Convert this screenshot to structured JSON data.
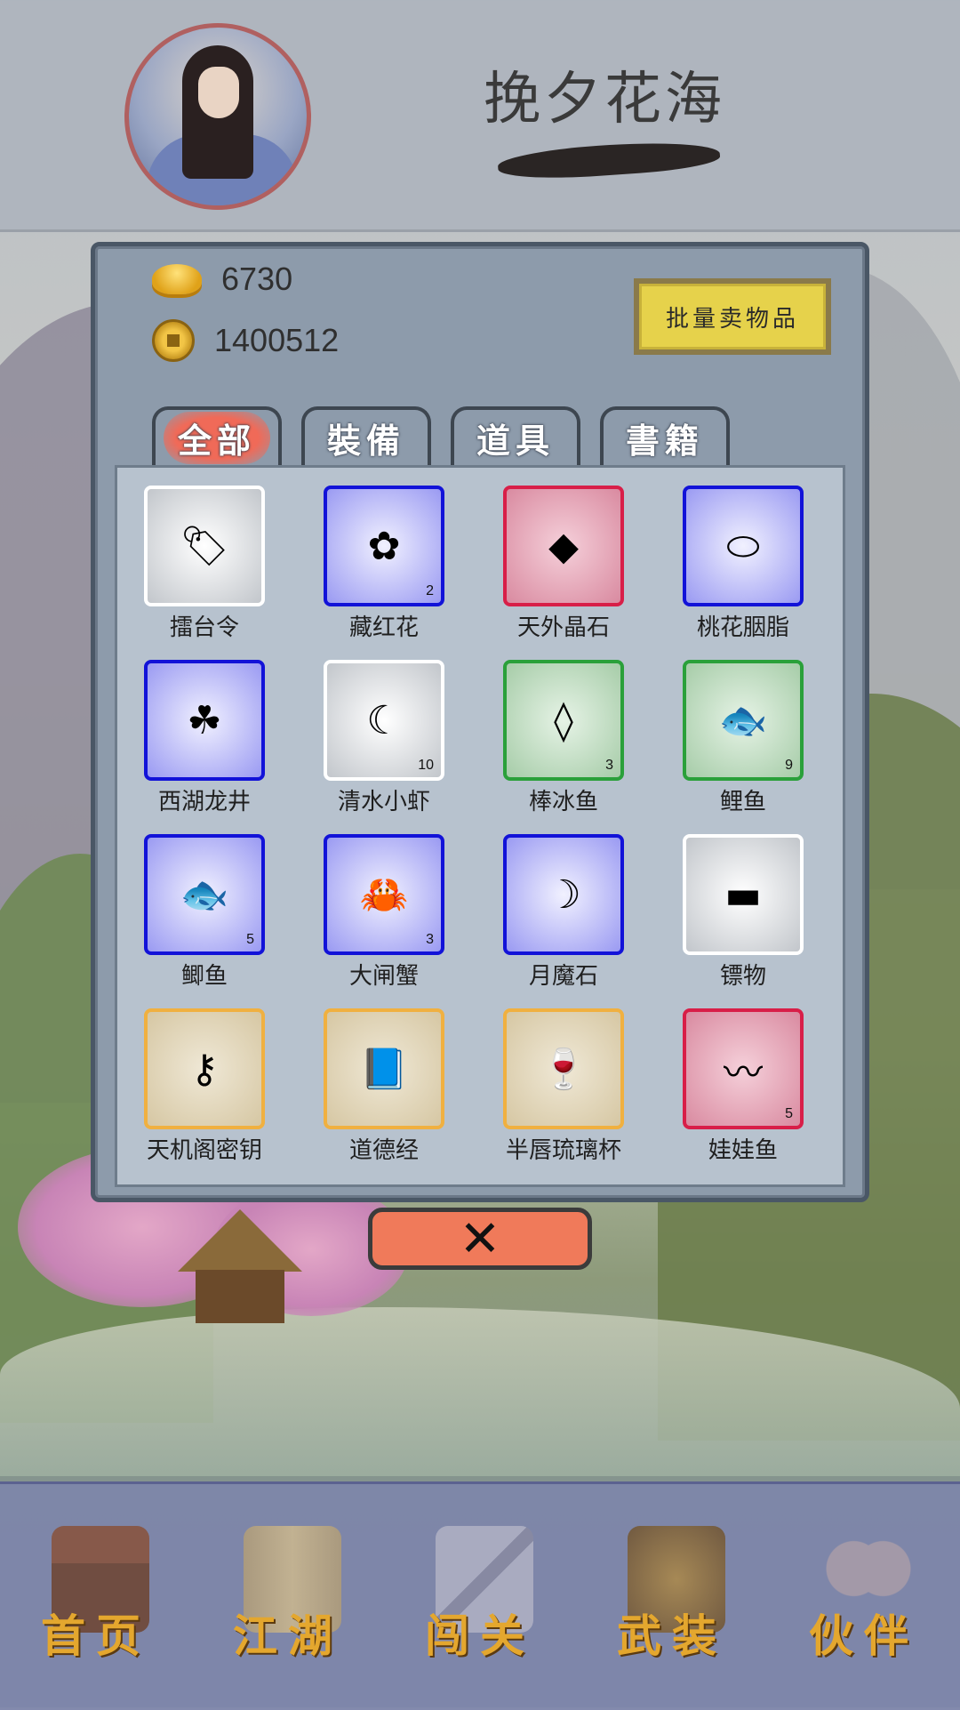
{
  "header": {
    "title": "挽夕花海",
    "avatar_icon": "character-portrait-icon"
  },
  "currency": {
    "gold": {
      "icon": "gold-ingot-icon",
      "value": "6730"
    },
    "coins": {
      "icon": "copper-coin-icon",
      "value": "1400512"
    }
  },
  "actions": {
    "bulk_sell_label": "批量卖物品",
    "close_label": "✕"
  },
  "tabs": [
    {
      "label": "全部",
      "active": true
    },
    {
      "label": "裝備",
      "active": false
    },
    {
      "label": "道具",
      "active": false
    },
    {
      "label": "書籍",
      "active": false
    }
  ],
  "inventory": [
    {
      "name": "擂台令",
      "count": "",
      "rarity": "white",
      "icon": "token-icon",
      "glyph": "🏷"
    },
    {
      "name": "藏红花",
      "count": "2",
      "rarity": "blue",
      "icon": "flower-icon",
      "glyph": "✿"
    },
    {
      "name": "天外晶石",
      "count": "",
      "rarity": "red",
      "icon": "crystal-icon",
      "glyph": "◆"
    },
    {
      "name": "桃花胭脂",
      "count": "",
      "rarity": "blue",
      "icon": "rouge-box-icon",
      "glyph": "⬭"
    },
    {
      "name": "西湖龙井",
      "count": "",
      "rarity": "blue",
      "icon": "tea-leaves-icon",
      "glyph": "☘"
    },
    {
      "name": "清水小虾",
      "count": "10",
      "rarity": "white",
      "icon": "shrimp-icon",
      "glyph": "☾"
    },
    {
      "name": "棒冰鱼",
      "count": "3",
      "rarity": "green",
      "icon": "ice-fish-icon",
      "glyph": "◊"
    },
    {
      "name": "鲤鱼",
      "count": "9",
      "rarity": "green",
      "icon": "carp-icon",
      "glyph": "🐟"
    },
    {
      "name": "鲫鱼",
      "count": "5",
      "rarity": "blue",
      "icon": "crucian-fish-icon",
      "glyph": "🐟"
    },
    {
      "name": "大闸蟹",
      "count": "3",
      "rarity": "blue",
      "icon": "crab-icon",
      "glyph": "🦀"
    },
    {
      "name": "月魔石",
      "count": "",
      "rarity": "blue",
      "icon": "moon-stone-icon",
      "glyph": "☽"
    },
    {
      "name": "镖物",
      "count": "",
      "rarity": "white",
      "icon": "cargo-chest-icon",
      "glyph": "▬"
    },
    {
      "name": "天机阁密钥",
      "count": "",
      "rarity": "orange",
      "icon": "secret-key-icon",
      "glyph": "⚷"
    },
    {
      "name": "道德经",
      "count": "",
      "rarity": "orange",
      "icon": "book-icon",
      "glyph": "📘"
    },
    {
      "name": "半唇琉璃杯",
      "count": "",
      "rarity": "orange",
      "icon": "glass-cup-icon",
      "glyph": "🍷"
    },
    {
      "name": "娃娃鱼",
      "count": "5",
      "rarity": "red",
      "icon": "salamander-icon",
      "glyph": "〰"
    }
  ],
  "bottom_nav": [
    {
      "label": "首页",
      "icon": "pavilion-icon"
    },
    {
      "label": "江湖",
      "icon": "scroll-icon"
    },
    {
      "label": "闯关",
      "icon": "crossed-swords-icon"
    },
    {
      "label": "武装",
      "icon": "armor-icon"
    },
    {
      "label": "伙伴",
      "icon": "companions-icon"
    }
  ],
  "colors": {
    "rarity_white": "#ffffff",
    "rarity_blue": "#1212d8",
    "rarity_red": "#d81e48",
    "rarity_green": "#2aa03a",
    "rarity_orange": "#f0b040",
    "close_button": "#f07a5a",
    "sell_button": "#e6d24b",
    "nav_label": "#e4a72e"
  }
}
